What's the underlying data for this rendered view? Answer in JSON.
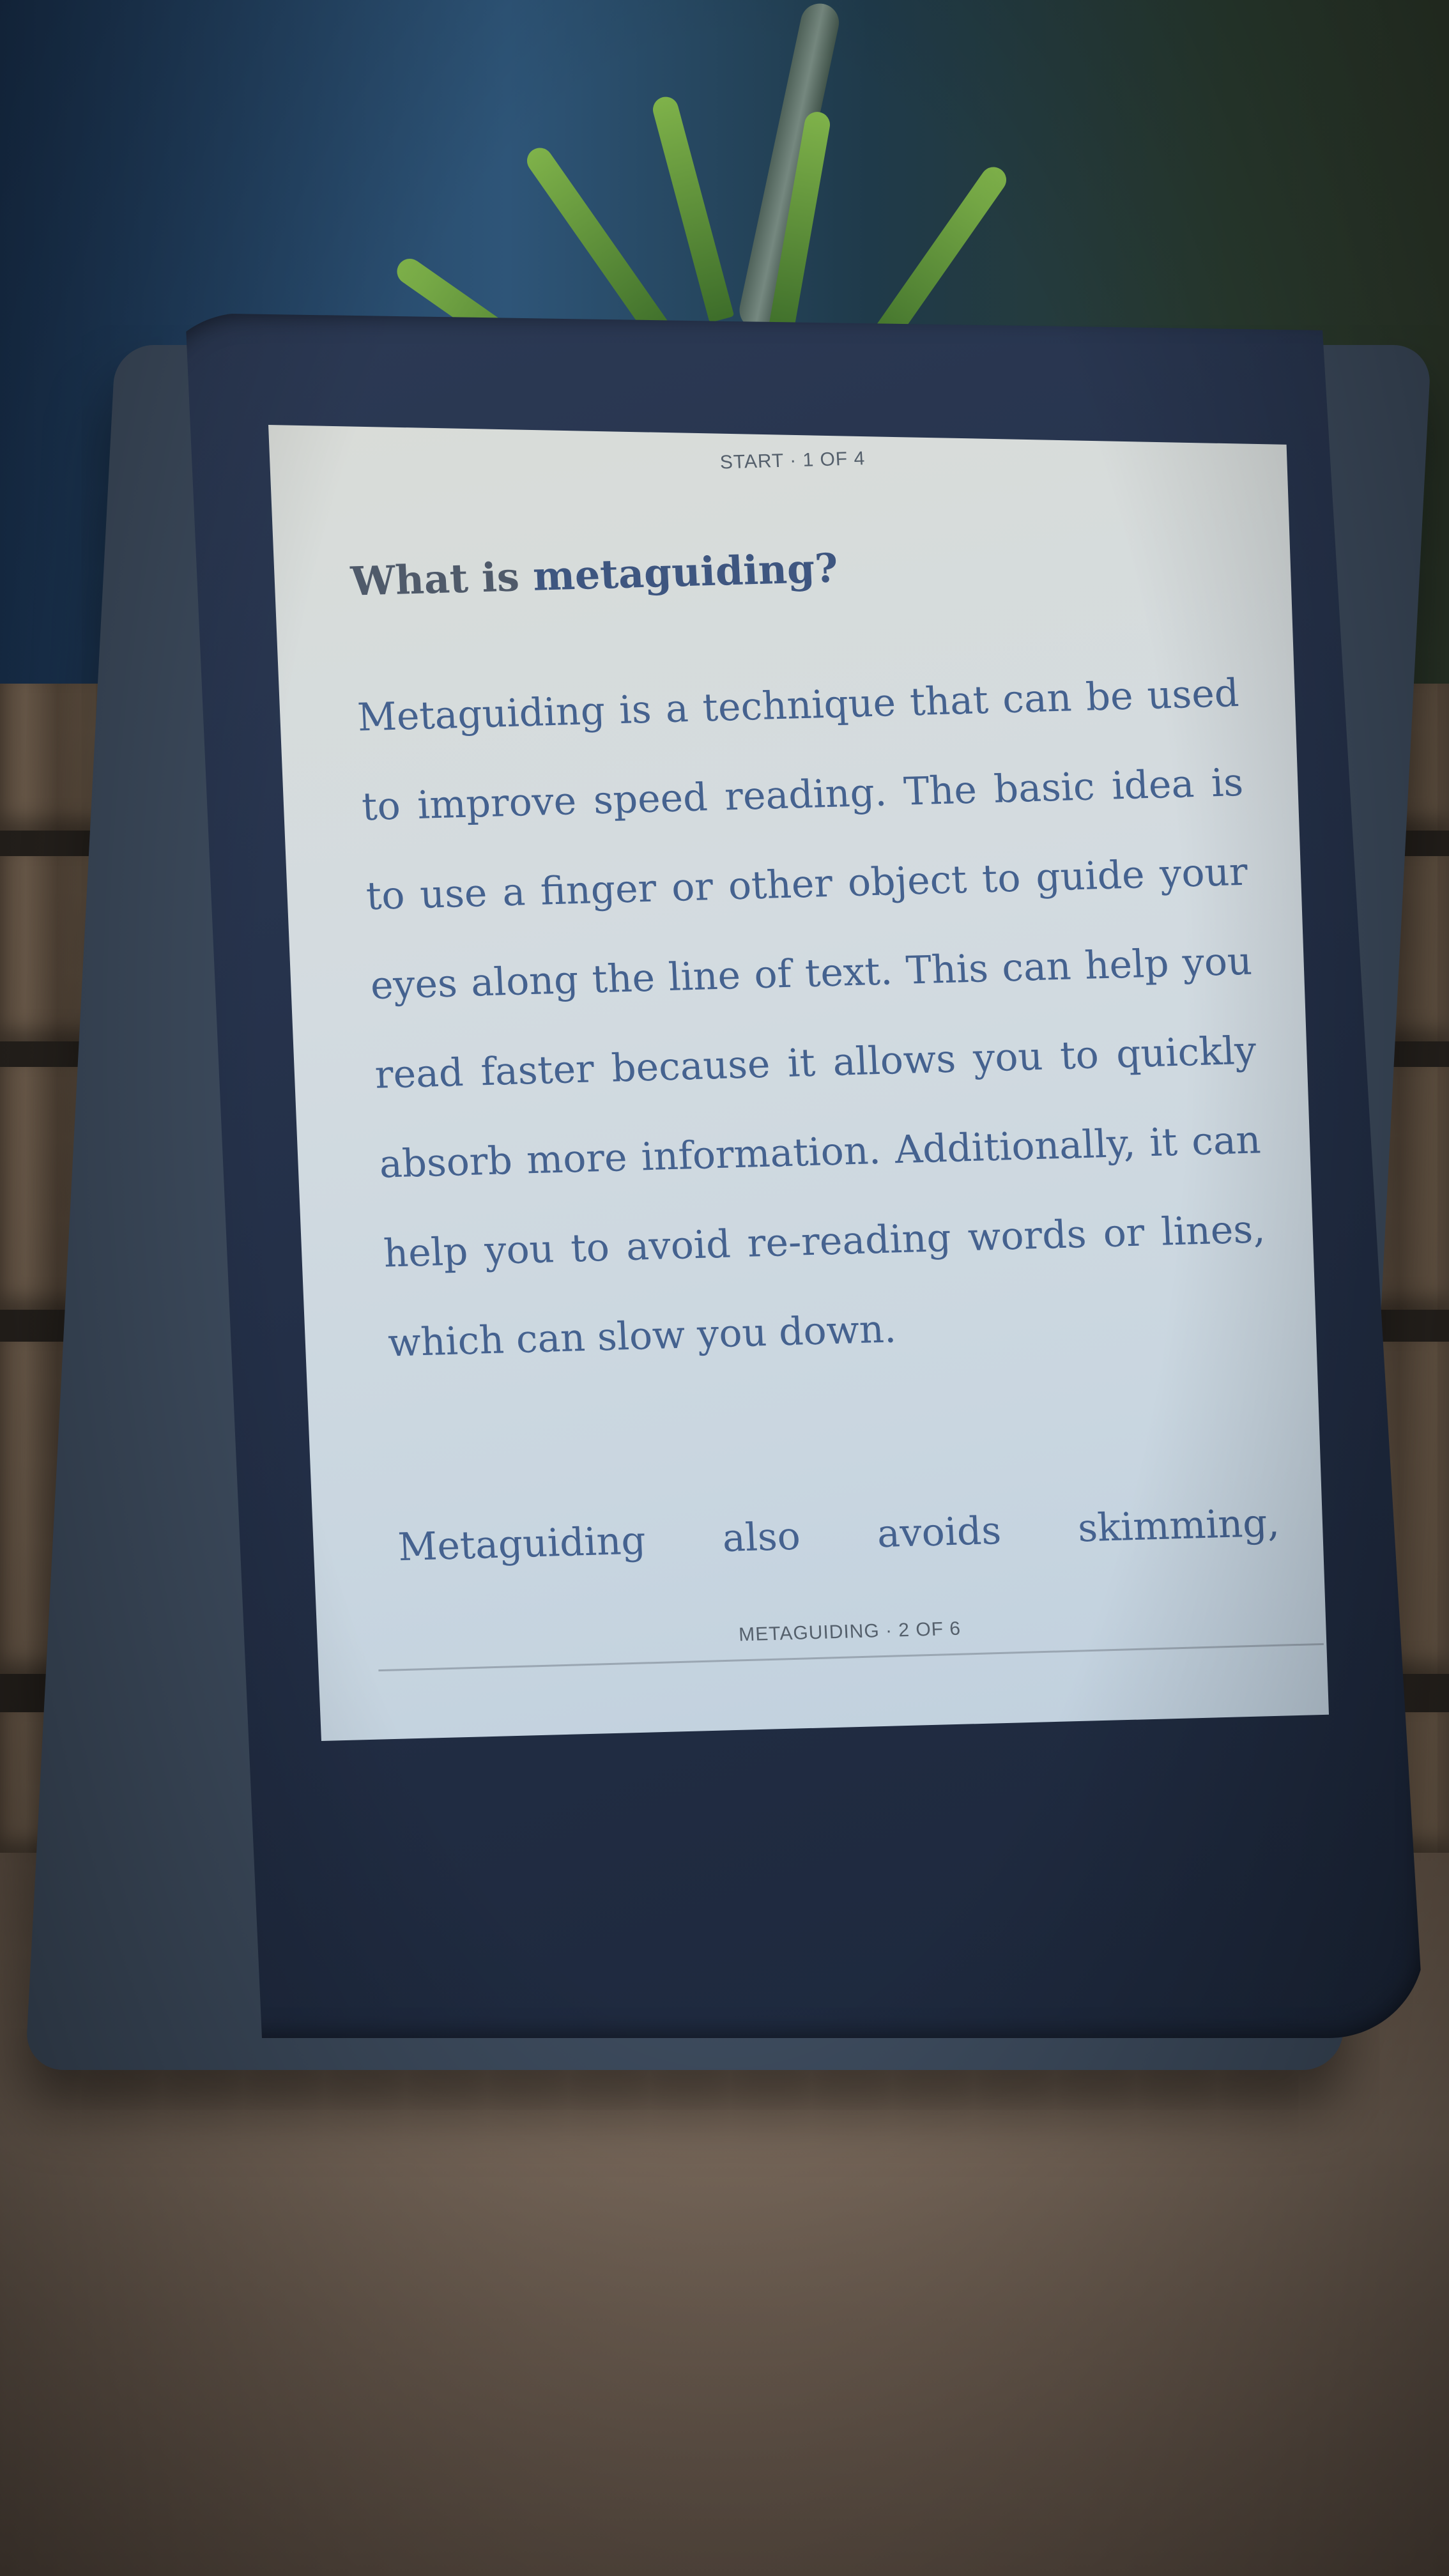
{
  "reader": {
    "header": "START · 1 OF 4",
    "heading": {
      "prefix": "What is ",
      "emphasis": "metaguiding?"
    },
    "paragraph_1": "Metaguiding is a technique that can be used to improve speed reading. The basic idea is to use a finger or other object to guide your eyes along the line of text. This can help you read faster because it allows you to quickly absorb more information. Additionally, it can help you to avoid re-reading words or lines, which can slow you down.",
    "paragraph_2": "Metaguiding also avoids skimming,",
    "footer": "METAGUIDING · 2 OF 6"
  },
  "colors": {
    "screen": "#d3dbe0",
    "text": "#45628f",
    "bezel": "#232f47"
  }
}
